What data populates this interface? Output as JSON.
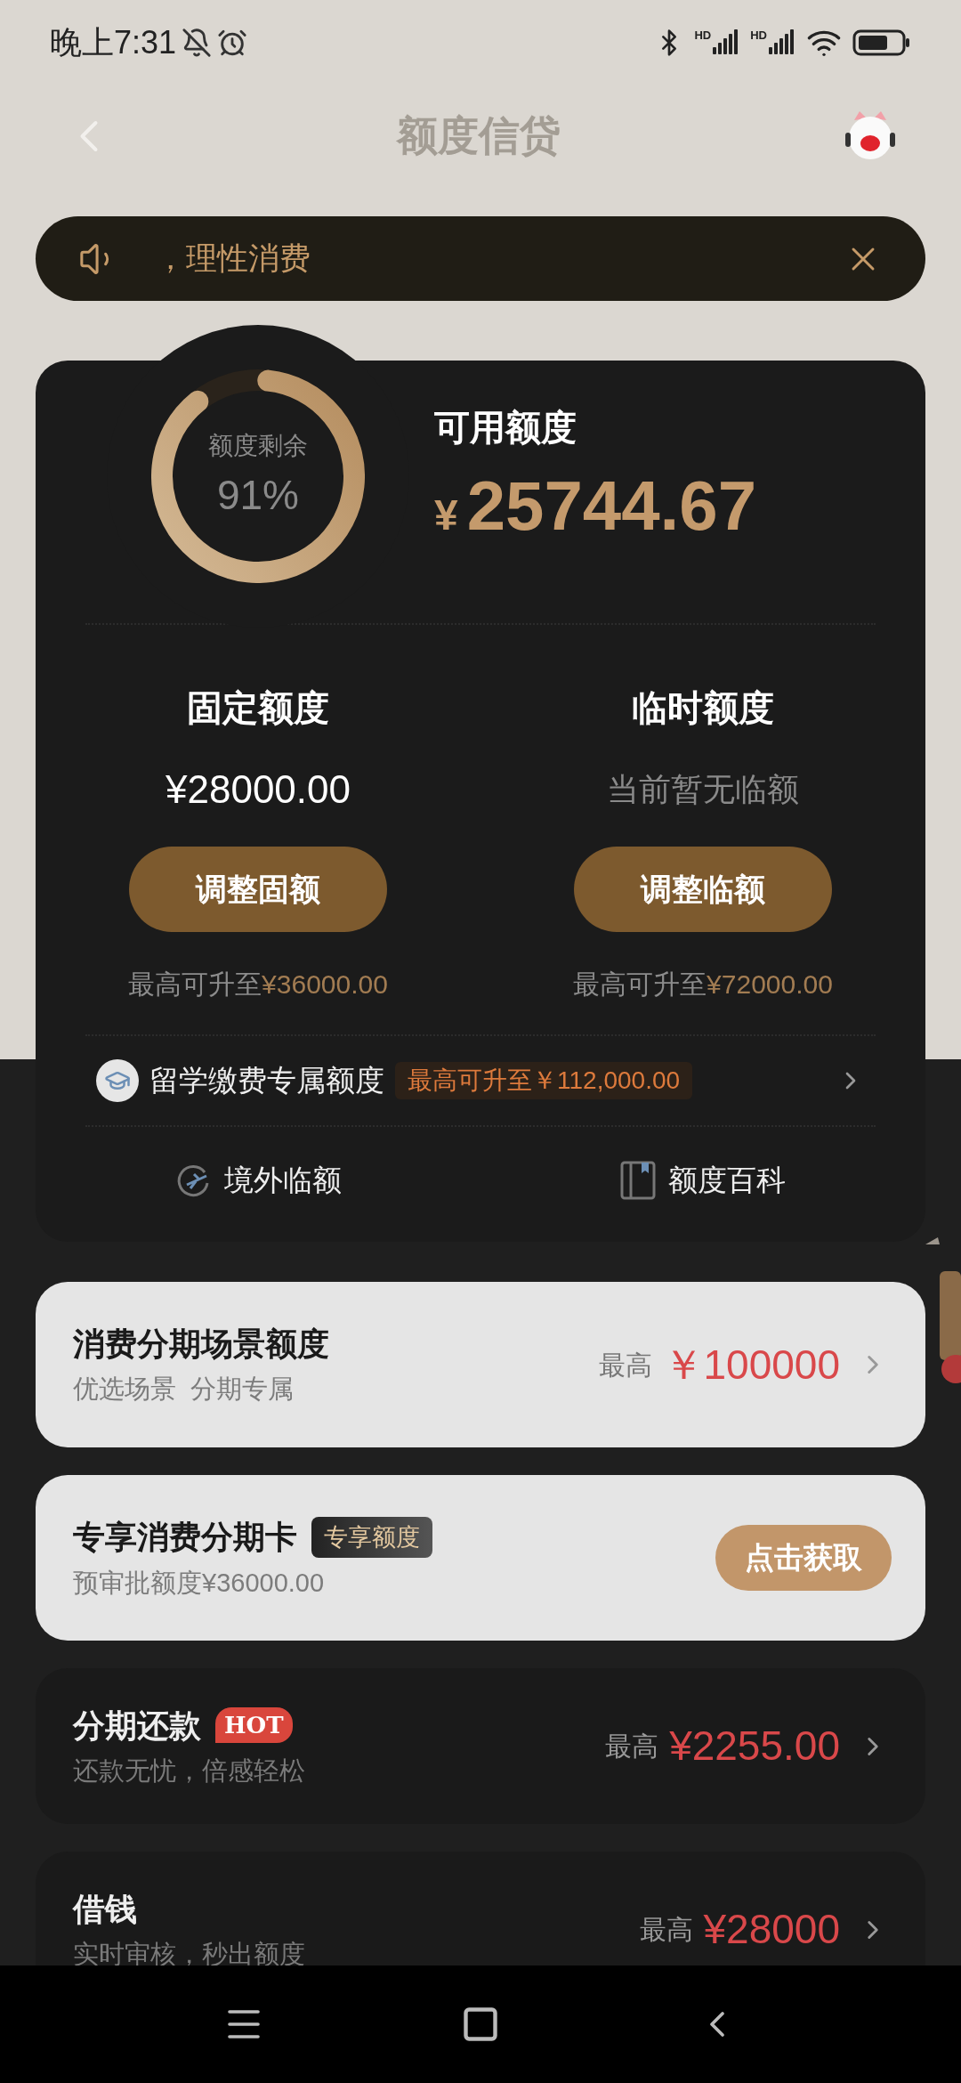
{
  "status_bar": {
    "time": "晚上7:31",
    "signals": [
      {
        "label": "HD"
      },
      {
        "label": "HD"
      }
    ]
  },
  "header": {
    "title": "额度信贷"
  },
  "notice": {
    "text": "，理性消费"
  },
  "credit": {
    "ring_label": "额度剩余",
    "ring_value": "91%",
    "available_label": "可用额度",
    "currency": "¥",
    "available_amount": "25744.67",
    "quotas": [
      {
        "title": "固定额度",
        "value": "¥28000.00",
        "kind": "amount",
        "button": "调整固额",
        "upgrade_label": "最高可升至",
        "upgrade_amount": "¥36000.00"
      },
      {
        "title": "临时额度",
        "value": "当前暂无临额",
        "kind": "empty",
        "button": "调整临额",
        "upgrade_label": "最高可升至",
        "upgrade_amount": "¥72000.00"
      }
    ],
    "study": {
      "label": "留学缴费专属额度",
      "badge": "最高可升至￥112,000.00"
    },
    "links": [
      {
        "label": "境外临额",
        "kind": "plane"
      },
      {
        "label": "额度百科",
        "kind": "book"
      }
    ]
  },
  "products": [
    {
      "kind": "light",
      "title": "消费分期场景额度",
      "subtitle": "优选场景  分期专属",
      "prefix": "最高",
      "amount": "￥100000"
    },
    {
      "kind": "light",
      "title": "专享消费分期卡",
      "tag": {
        "text": "专享额度",
        "kind": "dark"
      },
      "subtitle": "预审批额度¥36000.00",
      "button": "点击获取"
    },
    {
      "kind": "dark",
      "title": "分期还款",
      "tag": {
        "text": "HOT",
        "kind": "hot"
      },
      "subtitle": "还款无忧，倍感轻松",
      "prefix": "最高",
      "amount": "¥2255.00"
    },
    {
      "kind": "dark",
      "title": "借钱",
      "subtitle": "实时审核，秒出额度",
      "prefix": "最高",
      "amount": "¥28000"
    }
  ]
}
